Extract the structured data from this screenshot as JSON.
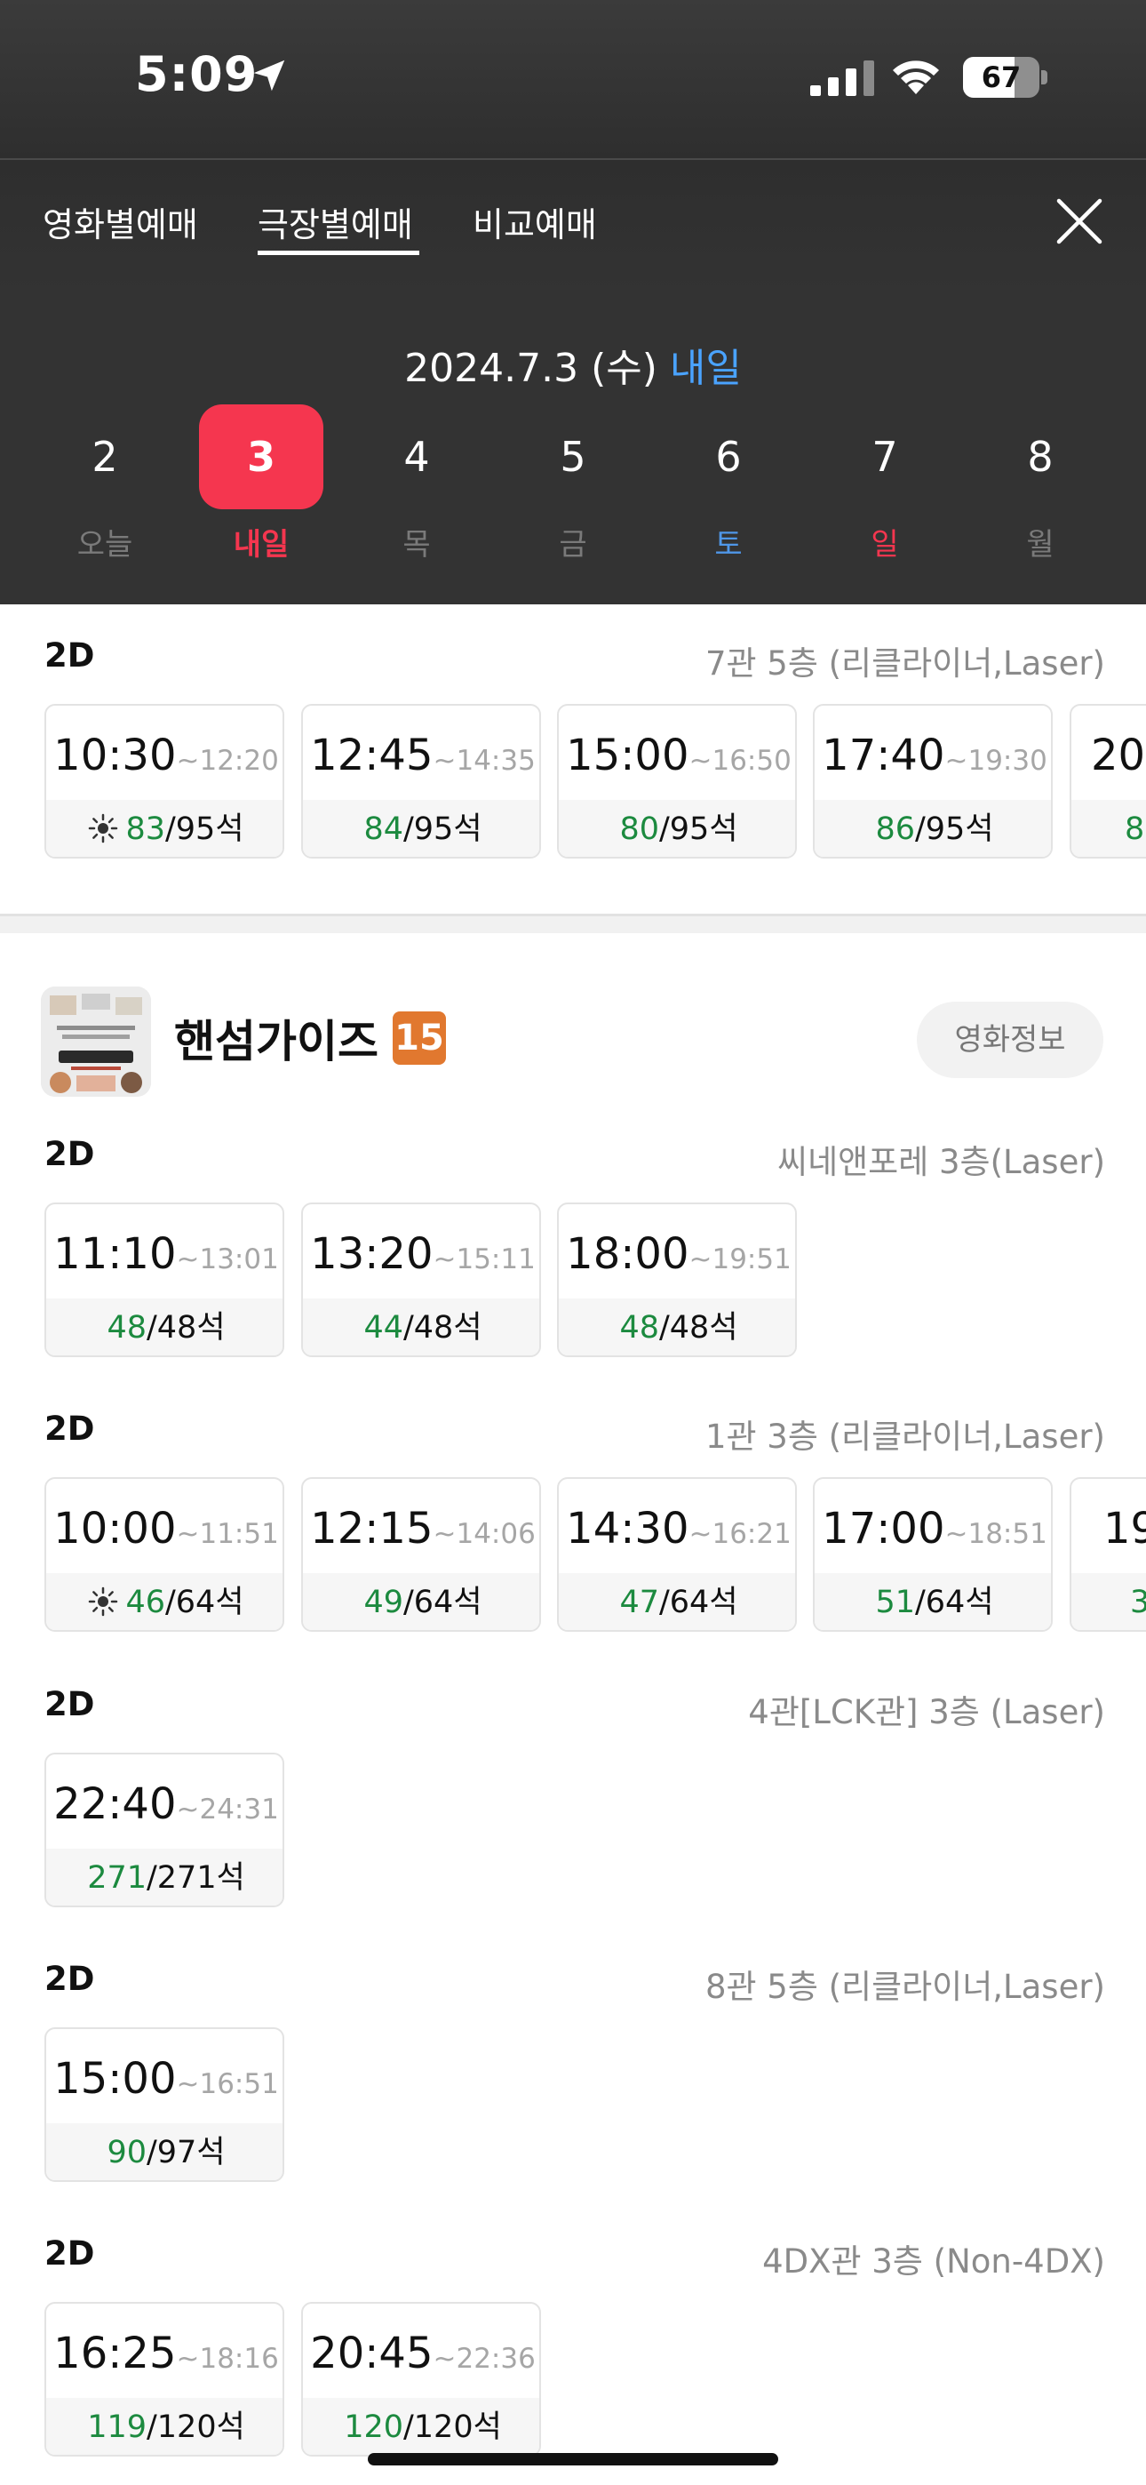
{
  "status_bar": {
    "time": "5:09",
    "battery": "67",
    "battery_level": 0.67
  },
  "tabs": [
    {
      "label": "영화별예매",
      "active": false
    },
    {
      "label": "극장별예매",
      "active": true
    },
    {
      "label": "비교예매",
      "active": false
    }
  ],
  "date_header": {
    "date": "2024.7.3 (수)",
    "relative": "내일"
  },
  "days": [
    {
      "num": "2",
      "label": "오늘",
      "kind": "normal"
    },
    {
      "num": "3",
      "label": "내일",
      "kind": "selected"
    },
    {
      "num": "4",
      "label": "목",
      "kind": "normal"
    },
    {
      "num": "5",
      "label": "금",
      "kind": "normal"
    },
    {
      "num": "6",
      "label": "토",
      "kind": "sat"
    },
    {
      "num": "7",
      "label": "일",
      "kind": "sun"
    },
    {
      "num": "8",
      "label": "월",
      "kind": "normal"
    }
  ],
  "movie": {
    "title": "핸섬가이즈",
    "rating": "15",
    "info_button": "영화정보"
  },
  "groups": [
    {
      "format": "2D",
      "hall": "7관 5층 (리클라이너,Laser)",
      "times": [
        {
          "start": "10:30",
          "end": "~12:20",
          "avail": "83",
          "total": "/95석",
          "morning": true
        },
        {
          "start": "12:45",
          "end": "~14:35",
          "avail": "84",
          "total": "/95석",
          "morning": false
        },
        {
          "start": "15:00",
          "end": "~16:50",
          "avail": "80",
          "total": "/95석",
          "morning": false
        },
        {
          "start": "17:40",
          "end": "~19:30",
          "avail": "86",
          "total": "/95석",
          "morning": false
        },
        {
          "start": "20:",
          "end": "",
          "avail": "8",
          "total": "",
          "morning": false
        }
      ]
    },
    {
      "format": "2D",
      "hall": "씨네앤포레 3층(Laser)",
      "times": [
        {
          "start": "11:10",
          "end": "~13:01",
          "avail": "48",
          "total": "/48석",
          "morning": false
        },
        {
          "start": "13:20",
          "end": "~15:11",
          "avail": "44",
          "total": "/48석",
          "morning": false
        },
        {
          "start": "18:00",
          "end": "~19:51",
          "avail": "48",
          "total": "/48석",
          "morning": false
        }
      ]
    },
    {
      "format": "2D",
      "hall": "1관 3층 (리클라이너,Laser)",
      "times": [
        {
          "start": "10:00",
          "end": "~11:51",
          "avail": "46",
          "total": "/64석",
          "morning": true
        },
        {
          "start": "12:15",
          "end": "~14:06",
          "avail": "49",
          "total": "/64석",
          "morning": false
        },
        {
          "start": "14:30",
          "end": "~16:21",
          "avail": "47",
          "total": "/64석",
          "morning": false
        },
        {
          "start": "17:00",
          "end": "~18:51",
          "avail": "51",
          "total": "/64석",
          "morning": false
        },
        {
          "start": "19",
          "end": "",
          "avail": "3",
          "total": "",
          "morning": false
        }
      ]
    },
    {
      "format": "2D",
      "hall": "4관[LCK관] 3층 (Laser)",
      "times": [
        {
          "start": "22:40",
          "end": "~24:31",
          "avail": "271",
          "total": "/271석",
          "morning": false
        }
      ]
    },
    {
      "format": "2D",
      "hall": "8관 5층 (리클라이너,Laser)",
      "times": [
        {
          "start": "15:00",
          "end": "~16:51",
          "avail": "90",
          "total": "/97석",
          "morning": false
        }
      ]
    },
    {
      "format": "2D",
      "hall": "4DX관 3층 (Non-4DX)",
      "times": [
        {
          "start": "16:25",
          "end": "~18:16",
          "avail": "119",
          "total": "/120석",
          "morning": false
        },
        {
          "start": "20:45",
          "end": "~22:36",
          "avail": "120",
          "total": "/120석",
          "morning": false
        }
      ]
    }
  ]
}
